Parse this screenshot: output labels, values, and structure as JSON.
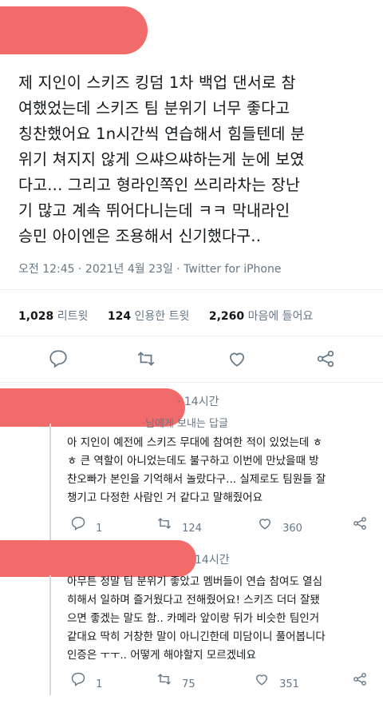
{
  "tweet": {
    "lines": [
      "제 지인이 스키즈 킹덤 1차 백업 댄서로 참",
      "여했었는데 스키즈 팀 분위기 너무 좋다고",
      "칭찬했어요 1n시간씩 연습해서 힘들텐데 분",
      "위기 쳐지지 않게 으쌰으쌰하는게 눈에 보였",
      "다고... 그리고 형라인쪽인 쓰리라차는 장난",
      "기 많고 계속 뛰어다니는데 ㅋㅋ 막내라인",
      "승민 아이엔은 조용해서 신기했다구.."
    ],
    "meta": "오전 12:45 · 2021년 4월 23일 · Twitter for iPhone",
    "stats": [
      {
        "count": "1,028",
        "label": "리트윗"
      },
      {
        "count": "124",
        "label": "인용한 트윗"
      },
      {
        "count": "2,260",
        "label": "마음에 들어요"
      }
    ]
  },
  "replies": [
    {
      "time": "· 14시간",
      "to": "님에게 보내는 답글",
      "lines": [
        "아 지인이 예전에 스키즈 무대에 참여한 적이 있었는데 ㅎ",
        "ㅎ 큰 역할이 아니었는데도 불구하고 이번에 만났을때 방",
        "찬오빠가 본인을 기억해서 놀랐다구... 실제로도 팀원들 잘",
        "챙기고 다정한 사람인 거 같다고 말해줬어요"
      ],
      "replies_count": "1",
      "retweets": "124",
      "likes": "360"
    },
    {
      "time": "14시간",
      "lines": [
        "아무튼 정말 팀 분위기 좋았고 멤버들이 연습 참여도 열심",
        "히해서 일하며 즐거웠다고 전해줬어요! 스키즈 더더 잘됐",
        "으면 좋겠는 말도 함.. 카메라 앞이랑 뒤가 비슷한 팀인거",
        "같대요 딱히 거창한 말이 아니긴한데 미담이니 풀어봅니다",
        "인증은 ㅜㅜ.. 어떻게 해야할지 모르겠네요"
      ],
      "replies_count": "1",
      "retweets": "75",
      "likes": "351"
    }
  ],
  "colors": {
    "redaction": "#f26b6b",
    "text": "#14171a",
    "secondary": "#657786",
    "icon": "#1da1f2"
  }
}
